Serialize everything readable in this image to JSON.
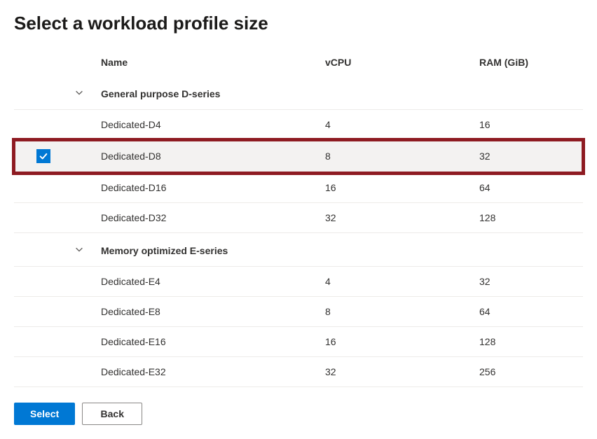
{
  "title": "Select a workload profile size",
  "columns": {
    "name": "Name",
    "vcpu": "vCPU",
    "ram": "RAM (GiB)"
  },
  "groups": [
    {
      "label": "General purpose D-series",
      "rows": [
        {
          "name": "Dedicated-D4",
          "vcpu": "4",
          "ram": "16",
          "selected": false
        },
        {
          "name": "Dedicated-D8",
          "vcpu": "8",
          "ram": "32",
          "selected": true
        },
        {
          "name": "Dedicated-D16",
          "vcpu": "16",
          "ram": "64",
          "selected": false
        },
        {
          "name": "Dedicated-D32",
          "vcpu": "32",
          "ram": "128",
          "selected": false
        }
      ]
    },
    {
      "label": "Memory optimized E-series",
      "rows": [
        {
          "name": "Dedicated-E4",
          "vcpu": "4",
          "ram": "32",
          "selected": false
        },
        {
          "name": "Dedicated-E8",
          "vcpu": "8",
          "ram": "64",
          "selected": false
        },
        {
          "name": "Dedicated-E16",
          "vcpu": "16",
          "ram": "128",
          "selected": false
        },
        {
          "name": "Dedicated-E32",
          "vcpu": "32",
          "ram": "256",
          "selected": false
        }
      ]
    }
  ],
  "buttons": {
    "select": "Select",
    "back": "Back"
  },
  "colors": {
    "accent": "#0078d4",
    "highlight": "#8e1b22"
  }
}
